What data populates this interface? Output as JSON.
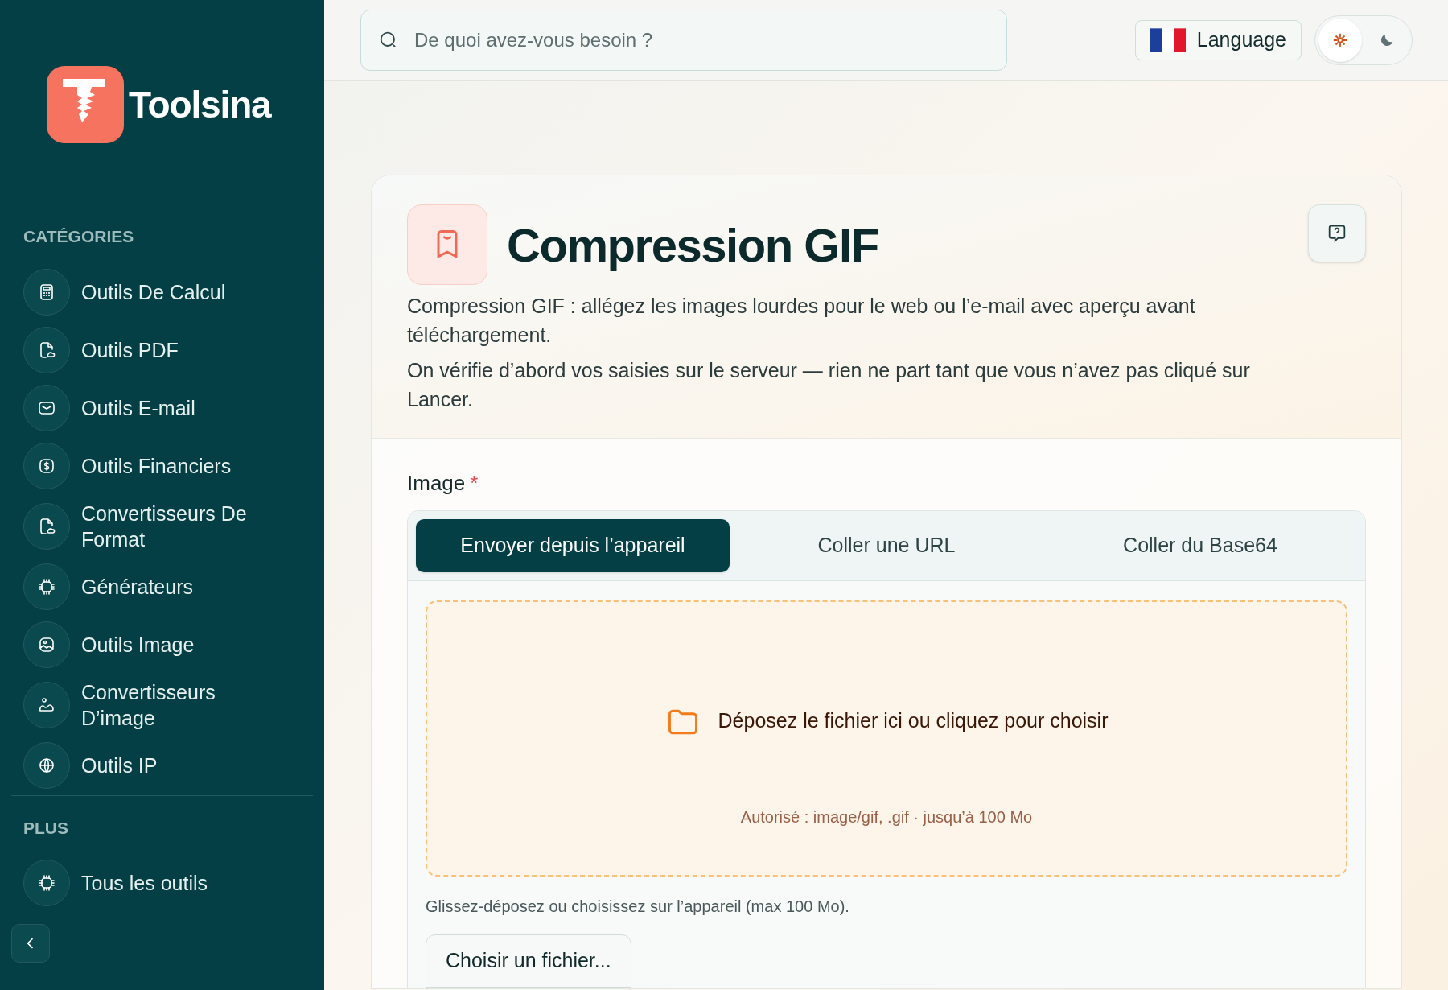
{
  "sidebar": {
    "logo": "Toolsina",
    "sections": [
      {
        "title": "CATÉGORIES",
        "items": [
          {
            "label": "Outils De Calcul"
          },
          {
            "label": "Outils PDF"
          },
          {
            "label": "Outils E-mail"
          },
          {
            "label": "Outils Financiers"
          },
          {
            "label": "Convertisseurs De Format"
          },
          {
            "label": "Générateurs"
          },
          {
            "label": "Outils Image"
          },
          {
            "label": "Convertisseurs D’image"
          },
          {
            "label": "Outils IP"
          }
        ]
      },
      {
        "title": "PLUS",
        "items": [
          {
            "label": "Tous les outils"
          }
        ]
      }
    ]
  },
  "header": {
    "search": {
      "placeholder": "De quoi avez-vous besoin ?"
    },
    "language": "Language",
    "theme": [
      {
        "kind": "light",
        "selected": true
      },
      {
        "kind": "dark",
        "selected": false
      }
    ]
  },
  "tool": {
    "title": "Compression GIF",
    "description": [
      "Compression GIF : allégez les images lourdes pour le web ou l’e-mail avec aperçu avant téléchargement.",
      "On vérifie d’abord vos saisies sur le serveur — rien ne part tant que vous n’avez pas cliqué sur Lancer."
    ],
    "field": {
      "label": "Image",
      "required": true,
      "required_mark": "*"
    },
    "tabs": [
      {
        "label": "Envoyer depuis l’appareil",
        "selected": true
      },
      {
        "label": "Coller une URL",
        "selected": false
      },
      {
        "label": "Coller du Base64",
        "selected": false
      }
    ],
    "dropzone": {
      "prompt": "Déposez le fichier ici ou cliquez pour choisir",
      "allowed": "Autorisé : image/gif, .gif · jusqu’à 100 Mo"
    },
    "hint": "Glissez-déposez ou choisissez sur l’appareil (max 100 Mo).",
    "choose_button": "Choisir un fichier..."
  }
}
